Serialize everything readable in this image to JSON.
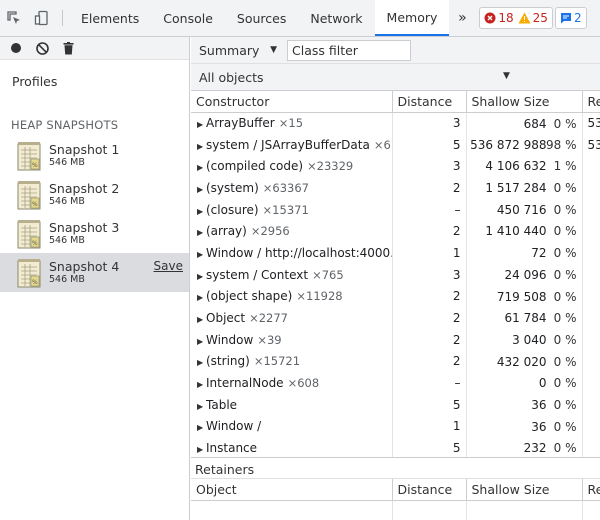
{
  "tabs": [
    {
      "label": "Elements",
      "active": false
    },
    {
      "label": "Console",
      "active": false
    },
    {
      "label": "Sources",
      "active": false
    },
    {
      "label": "Network",
      "active": false
    },
    {
      "label": "Memory",
      "active": true
    }
  ],
  "more_tabs": "»",
  "badges": {
    "errors": "18",
    "warnings": "25",
    "messages": "2"
  },
  "left": {
    "profiles_label": "Profiles",
    "section_label": "HEAP SNAPSHOTS",
    "snapshots": [
      {
        "title": "Snapshot 1",
        "size": "546 MB"
      },
      {
        "title": "Snapshot 2",
        "size": "546 MB"
      },
      {
        "title": "Snapshot 3",
        "size": "546 MB"
      },
      {
        "title": "Snapshot 4",
        "size": "546 MB",
        "selected": true,
        "action": "Save"
      }
    ]
  },
  "toolbar": {
    "view": "Summary",
    "filter_placeholder": "Class filter",
    "objects_select": "All objects"
  },
  "columns": {
    "constructor": "Constructor",
    "distance": "Distance",
    "shallow_size": "Shallow Size",
    "retained_size": "Re"
  },
  "rows": [
    {
      "name": "ArrayBuffer",
      "count": "×15",
      "distance": "3",
      "shallow": "684",
      "pct": "0 %",
      "retained": "53"
    },
    {
      "name": "system / JSArrayBufferData",
      "count": "×6",
      "distance": "5",
      "shallow": "536 872 988",
      "pct": "98 %",
      "retained": "53"
    },
    {
      "name": "(compiled code)",
      "count": "×23329",
      "distance": "3",
      "shallow": "4 106 632",
      "pct": "1 %",
      "retained": ""
    },
    {
      "name": "(system)",
      "count": "×63367",
      "distance": "2",
      "shallow": "1 517 284",
      "pct": "0 %",
      "retained": ""
    },
    {
      "name": "(closure)",
      "count": "×15371",
      "distance": "–",
      "shallow": "450 716",
      "pct": "0 %",
      "retained": ""
    },
    {
      "name": "(array)",
      "count": "×2956",
      "distance": "2",
      "shallow": "1 410 440",
      "pct": "0 %",
      "retained": ""
    },
    {
      "name": "Window / http://localhost:4000...",
      "count": "",
      "distance": "1",
      "shallow": "72",
      "pct": "0 %",
      "retained": ""
    },
    {
      "name": "system / Context",
      "count": "×765",
      "distance": "3",
      "shallow": "24 096",
      "pct": "0 %",
      "retained": ""
    },
    {
      "name": "(object shape)",
      "count": "×11928",
      "distance": "2",
      "shallow": "719 508",
      "pct": "0 %",
      "retained": ""
    },
    {
      "name": "Object",
      "count": "×2277",
      "distance": "2",
      "shallow": "61 784",
      "pct": "0 %",
      "retained": ""
    },
    {
      "name": "Window",
      "count": "×39",
      "distance": "2",
      "shallow": "3 040",
      "pct": "0 %",
      "retained": ""
    },
    {
      "name": "(string)",
      "count": "×15721",
      "distance": "2",
      "shallow": "432 020",
      "pct": "0 %",
      "retained": ""
    },
    {
      "name": "InternalNode",
      "count": "×608",
      "distance": "–",
      "shallow": "0",
      "pct": "0 %",
      "retained": ""
    },
    {
      "name": "Table",
      "count": "",
      "distance": "5",
      "shallow": "36",
      "pct": "0 %",
      "retained": ""
    },
    {
      "name": "Window /",
      "count": "",
      "distance": "1",
      "shallow": "36",
      "pct": "0 %",
      "retained": ""
    },
    {
      "name": "Instance",
      "count": "",
      "distance": "5",
      "shallow": "232",
      "pct": "0 %",
      "retained": ""
    }
  ],
  "retainers": {
    "title": "Retainers",
    "columns": {
      "object": "Object",
      "distance": "Distance",
      "shallow_size": "Shallow Size",
      "retained_size": "Re"
    }
  },
  "colors": {
    "accent": "#1a73e8",
    "error": "#c5221f",
    "warning": "#f9ab00"
  }
}
